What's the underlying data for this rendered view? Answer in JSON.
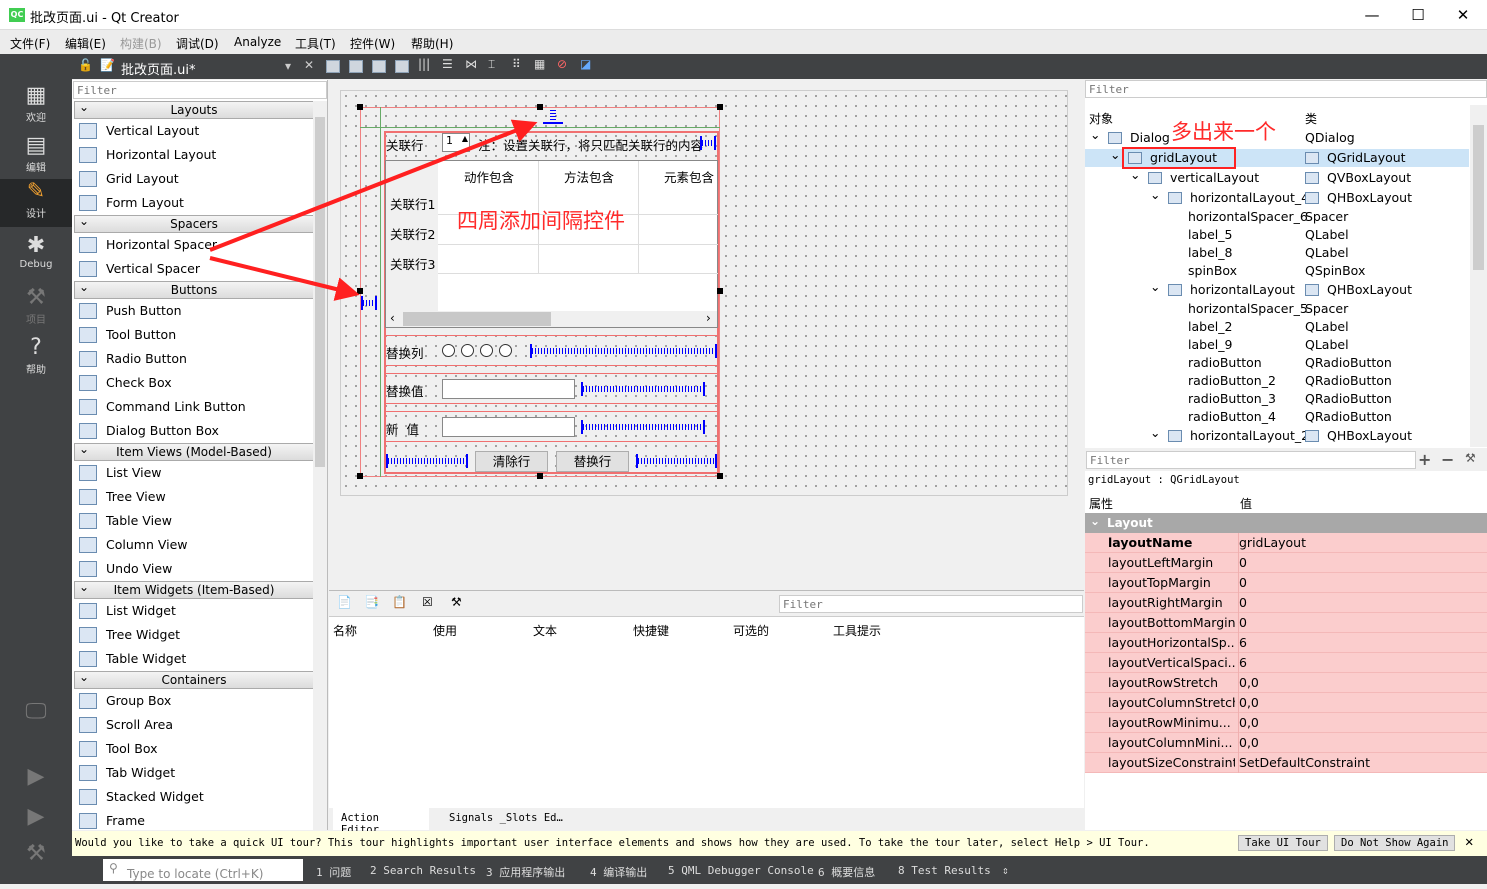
{
  "window": {
    "title": "批改页面.ui - Qt Creator",
    "app_icon": "QC"
  },
  "menu": [
    "文件(F)",
    "编辑(E)",
    "构建(B)",
    "调试(D)",
    "Analyze",
    "工具(T)",
    "控件(W)",
    "帮助(H)"
  ],
  "toolbar": {
    "file": "批改页面.ui*"
  },
  "modes": [
    "欢迎",
    "编辑",
    "设计",
    "Debug",
    "项目",
    "帮助"
  ],
  "widgetbox": {
    "filter_placeholder": "Filter",
    "sections": [
      {
        "title": "Layouts",
        "items": [
          "Vertical Layout",
          "Horizontal Layout",
          "Grid Layout",
          "Form Layout"
        ]
      },
      {
        "title": "Spacers",
        "items": [
          "Horizontal Spacer",
          "Vertical Spacer"
        ]
      },
      {
        "title": "Buttons",
        "items": [
          "Push Button",
          "Tool Button",
          "Radio Button",
          "Check Box",
          "Command Link Button",
          "Dialog Button Box"
        ]
      },
      {
        "title": "Item Views (Model-Based)",
        "items": [
          "List View",
          "Tree View",
          "Table View",
          "Column View",
          "Undo View"
        ]
      },
      {
        "title": "Item Widgets (Item-Based)",
        "items": [
          "List Widget",
          "Tree Widget",
          "Table Widget"
        ]
      },
      {
        "title": "Containers",
        "items": [
          "Group Box",
          "Scroll Area",
          "Tool Box",
          "Tab Widget",
          "Stacked Widget",
          "Frame"
        ]
      }
    ]
  },
  "form": {
    "row_label": "关联行",
    "spin_value": "1",
    "note": "注：设置关联行，将只匹配关联行的内容",
    "table_headers": [
      "动作包含",
      "方法包含",
      "元素包含"
    ],
    "table_rows": [
      "关联行1",
      "关联行2",
      "关联行3"
    ],
    "replace_col": "替换列",
    "replace_val": "替换值",
    "new_val": "新  值",
    "clear_btn": "清除行",
    "replace_btn": "替换行"
  },
  "annotations": {
    "canvas": "四周添加间隔控件",
    "tree": "多出来一个"
  },
  "action_editor": {
    "filter_placeholder": "Filter",
    "columns": [
      "名称",
      "使用",
      "文本",
      "快捷键",
      "可选的",
      "工具提示"
    ],
    "tabs": [
      "Action Editor",
      "Signals _Slots Ed…"
    ]
  },
  "object_inspector": {
    "filter_placeholder": "Filter",
    "col_object": "对象",
    "col_class": "类",
    "rows": [
      {
        "name": "Dialog",
        "cls": "QDialog",
        "level": 0
      },
      {
        "name": "gridLayout",
        "cls": "QGridLayout",
        "level": 1,
        "selected": true
      },
      {
        "name": "verticalLayout",
        "cls": "QVBoxLayout",
        "level": 2
      },
      {
        "name": "horizontalLayout_4",
        "cls": "QHBoxLayout",
        "level": 3
      },
      {
        "name": "horizontalSpacer_6",
        "cls": "Spacer",
        "level": 4
      },
      {
        "name": "label_5",
        "cls": "QLabel",
        "level": 4
      },
      {
        "name": "label_8",
        "cls": "QLabel",
        "level": 4
      },
      {
        "name": "spinBox",
        "cls": "QSpinBox",
        "level": 4
      },
      {
        "name": "horizontalLayout",
        "cls": "QHBoxLayout",
        "level": 3
      },
      {
        "name": "horizontalSpacer_5",
        "cls": "Spacer",
        "level": 4
      },
      {
        "name": "label_2",
        "cls": "QLabel",
        "level": 4
      },
      {
        "name": "label_9",
        "cls": "QLabel",
        "level": 4
      },
      {
        "name": "radioButton",
        "cls": "QRadioButton",
        "level": 4
      },
      {
        "name": "radioButton_2",
        "cls": "QRadioButton",
        "level": 4
      },
      {
        "name": "radioButton_3",
        "cls": "QRadioButton",
        "level": 4
      },
      {
        "name": "radioButton_4",
        "cls": "QRadioButton",
        "level": 4
      },
      {
        "name": "horizontalLayout_2",
        "cls": "QHBoxLayout",
        "level": 3
      }
    ]
  },
  "property_editor": {
    "filter_placeholder": "Filter",
    "object": "gridLayout : QGridLayout",
    "col_prop": "属性",
    "col_val": "值",
    "group": "Layout",
    "rows": [
      [
        "layoutName",
        "gridLayout"
      ],
      [
        "layoutLeftMargin",
        "0"
      ],
      [
        "layoutTopMargin",
        "0"
      ],
      [
        "layoutRightMargin",
        "0"
      ],
      [
        "layoutBottomMargin",
        "0"
      ],
      [
        "layoutHorizontalSp...",
        "6"
      ],
      [
        "layoutVerticalSpaci...",
        "6"
      ],
      [
        "layoutRowStretch",
        "0,0"
      ],
      [
        "layoutColumnStretch",
        "0,0"
      ],
      [
        "layoutRowMinimu...",
        "0,0"
      ],
      [
        "layoutColumnMini...",
        "0,0"
      ],
      [
        "layoutSizeConstraint",
        "SetDefaultConstraint"
      ]
    ]
  },
  "tour": {
    "message": "Would you like to take a quick UI tour? This tour highlights important user interface elements and shows how they are used. To take the tour later, select Help > UI Tour.",
    "take": "Take UI Tour",
    "dismiss": "Do Not Show Again"
  },
  "status": {
    "locate_placeholder": "Type to locate (Ctrl+K)",
    "panes": [
      "1 问题",
      "2 Search Results",
      "3 应用程序输出",
      "4 编译输出",
      "5 QML Debugger Console",
      "6 概要信息",
      "8 Test Results"
    ]
  }
}
